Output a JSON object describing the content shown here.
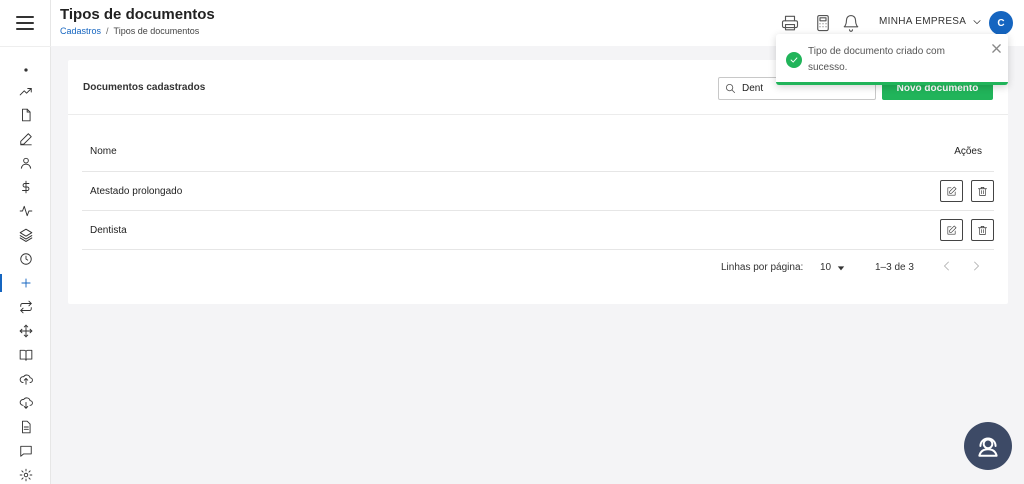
{
  "header": {
    "title": "Tipos de documentos",
    "breadcrumb": {
      "parent": "Cadastros",
      "separator": "/",
      "current": "Tipos de documentos"
    },
    "company": "MINHA EMPRESA",
    "avatar_initial": "C",
    "icons": [
      "printer-icon",
      "calculator-icon",
      "bell-icon"
    ]
  },
  "sidebar": {
    "items": [
      {
        "name": "dot-icon"
      },
      {
        "name": "trending-up-icon"
      },
      {
        "name": "file-icon"
      },
      {
        "name": "pen-icon"
      },
      {
        "name": "user-icon"
      },
      {
        "name": "dollar-icon"
      },
      {
        "name": "activity-icon"
      },
      {
        "name": "layers-icon"
      },
      {
        "name": "clock-icon"
      },
      {
        "name": "plus-icon",
        "active": true
      },
      {
        "name": "repeat-icon"
      },
      {
        "name": "move-icon"
      },
      {
        "name": "book-icon"
      },
      {
        "name": "upload-cloud-icon"
      },
      {
        "name": "download-cloud-icon"
      },
      {
        "name": "document-text-icon"
      },
      {
        "name": "chat-icon"
      },
      {
        "name": "settings-icon"
      }
    ]
  },
  "card": {
    "title": "Documentos cadastrados",
    "search": {
      "value": "Dent"
    },
    "new_button": "Novo documento"
  },
  "table": {
    "columns": {
      "name": "Nome",
      "actions": "Ações"
    },
    "rows": [
      {
        "name": "Atestado prolongado"
      },
      {
        "name": "Dentista"
      }
    ]
  },
  "pagination": {
    "rows_per_page_label": "Linhas por página:",
    "rows_per_page": "10",
    "range": "1–3 de 3"
  },
  "toast": {
    "message": "Tipo de documento criado com sucesso."
  },
  "colors": {
    "accent": "#1565c0",
    "success": "#21b45a",
    "fab": "#3d4a66"
  }
}
